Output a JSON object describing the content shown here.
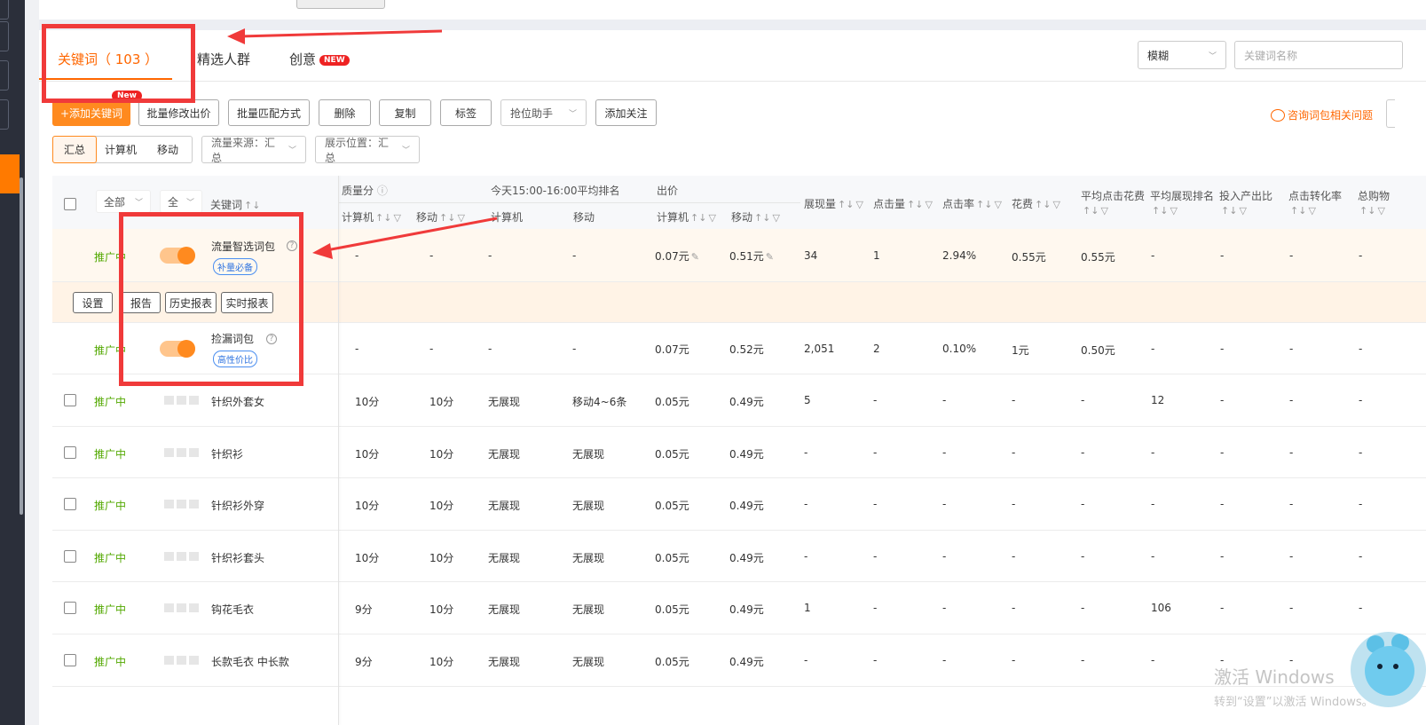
{
  "tabs": {
    "keywords": "关键词（ 103 ）",
    "audience": "精选人群",
    "creative": "创意",
    "creative_badge": "NEW"
  },
  "search": {
    "mode_selected": "模糊",
    "placeholder": "关键词名称"
  },
  "toolbar": {
    "new_badge": "New",
    "add_keyword": "+添加关键词",
    "batch_bid": "批量修改出价",
    "batch_match": "批量匹配方式",
    "delete": "删除",
    "copy": "复制",
    "tag": "标签",
    "rank_helper": "抢位助手",
    "add_follow": "添加关注",
    "help_link": "咨询词包相关问题"
  },
  "filters": {
    "device_tabs": [
      "汇总",
      "计算机",
      "移动"
    ],
    "traffic_source": "流量来源：汇总",
    "display_position": "展示位置：汇总"
  },
  "table": {
    "header": {
      "status_filter": "全部",
      "score_filter": "全",
      "keyword": "关键词",
      "quality_group": "质量分",
      "rank_group": "今天15:00-16:00平均排名",
      "bid_group": "出价",
      "pc": "计算机",
      "mobile": "移动",
      "impressions": "展现量",
      "clicks": "点击量",
      "ctr": "点击率",
      "cost": "花费",
      "avg_cpc": "平均点击花费",
      "avg_rank_l1": "平均展现排名",
      "roi": "投入产出比",
      "cvr": "点击转化率",
      "total_cart": "总购物"
    },
    "sort_glyph": "↑↓",
    "filter_glyph": "▽",
    "packages": [
      {
        "status": "推广中",
        "name": "流量智选词包",
        "tag": "补量必备",
        "quality_pc": "-",
        "quality_mobile": "-",
        "rank_pc": "-",
        "rank_mobile": "-",
        "bid_pc": "0.07元",
        "bid_mobile": "0.51元",
        "impressions": "34",
        "clicks": "1",
        "ctr": "2.94%",
        "cost": "0.55元",
        "avg_cpc": "0.55元",
        "avg_rank": "-",
        "roi": "-",
        "cvr": "-",
        "total_cart": "-"
      },
      {
        "status": "推广中",
        "name": "捡漏词包",
        "tag": "高性价比",
        "quality_pc": "-",
        "quality_mobile": "-",
        "rank_pc": "-",
        "rank_mobile": "-",
        "bid_pc": "0.07元",
        "bid_mobile": "0.52元",
        "impressions": "2,051",
        "clicks": "2",
        "ctr": "0.10%",
        "cost": "1元",
        "avg_cpc": "0.50元",
        "avg_rank": "-",
        "roi": "-",
        "cvr": "-",
        "total_cart": "-"
      }
    ],
    "package_actions": [
      "设置",
      "报告",
      "历史报表",
      "实时报表"
    ],
    "rows": [
      {
        "status": "推广中",
        "keyword": "针织外套女",
        "q_pc": "10分",
        "q_m": "10分",
        "r_pc": "无展现",
        "r_m": "移动4~6条",
        "b_pc": "0.05元",
        "b_m": "0.49元",
        "imp": "5",
        "clk": "-",
        "ctr": "-",
        "cost": "-",
        "cpc": "-",
        "rank": "12",
        "roi": "-",
        "cvr": "-",
        "cart": "-"
      },
      {
        "status": "推广中",
        "keyword": "针织衫",
        "q_pc": "10分",
        "q_m": "10分",
        "r_pc": "无展现",
        "r_m": "无展现",
        "b_pc": "0.05元",
        "b_m": "0.49元",
        "imp": "-",
        "clk": "-",
        "ctr": "-",
        "cost": "-",
        "cpc": "-",
        "rank": "-",
        "roi": "-",
        "cvr": "-",
        "cart": "-"
      },
      {
        "status": "推广中",
        "keyword": "针织衫外穿",
        "q_pc": "10分",
        "q_m": "10分",
        "r_pc": "无展现",
        "r_m": "无展现",
        "b_pc": "0.05元",
        "b_m": "0.49元",
        "imp": "-",
        "clk": "-",
        "ctr": "-",
        "cost": "-",
        "cpc": "-",
        "rank": "-",
        "roi": "-",
        "cvr": "-",
        "cart": "-"
      },
      {
        "status": "推广中",
        "keyword": "针织衫套头",
        "q_pc": "10分",
        "q_m": "10分",
        "r_pc": "无展现",
        "r_m": "无展现",
        "b_pc": "0.05元",
        "b_m": "0.49元",
        "imp": "-",
        "clk": "-",
        "ctr": "-",
        "cost": "-",
        "cpc": "-",
        "rank": "-",
        "roi": "-",
        "cvr": "-",
        "cart": "-"
      },
      {
        "status": "推广中",
        "keyword": "钩花毛衣",
        "q_pc": "9分",
        "q_m": "10分",
        "r_pc": "无展现",
        "r_m": "无展现",
        "b_pc": "0.05元",
        "b_m": "0.49元",
        "imp": "1",
        "clk": "-",
        "ctr": "-",
        "cost": "-",
        "cpc": "-",
        "rank": "106",
        "roi": "-",
        "cvr": "-",
        "cart": "-"
      },
      {
        "status": "推广中",
        "keyword": "长款毛衣 中长款",
        "q_pc": "9分",
        "q_m": "10分",
        "r_pc": "无展现",
        "r_m": "无展现",
        "b_pc": "0.05元",
        "b_m": "0.49元",
        "imp": "-",
        "clk": "-",
        "ctr": "-",
        "cost": "-",
        "cpc": "-",
        "rank": "-",
        "roi": "-",
        "cvr": "-",
        "cart": "-"
      }
    ]
  },
  "watermark": {
    "line1": "激活 Windows",
    "line2": "转到“设置”以激活 Windows。"
  },
  "colors": {
    "accent": "#ff6600",
    "primary_button": "#ff8a1f",
    "status_green": "#52a800",
    "annotation_red": "#f03a3a",
    "tag_blue": "#2f74e0"
  }
}
